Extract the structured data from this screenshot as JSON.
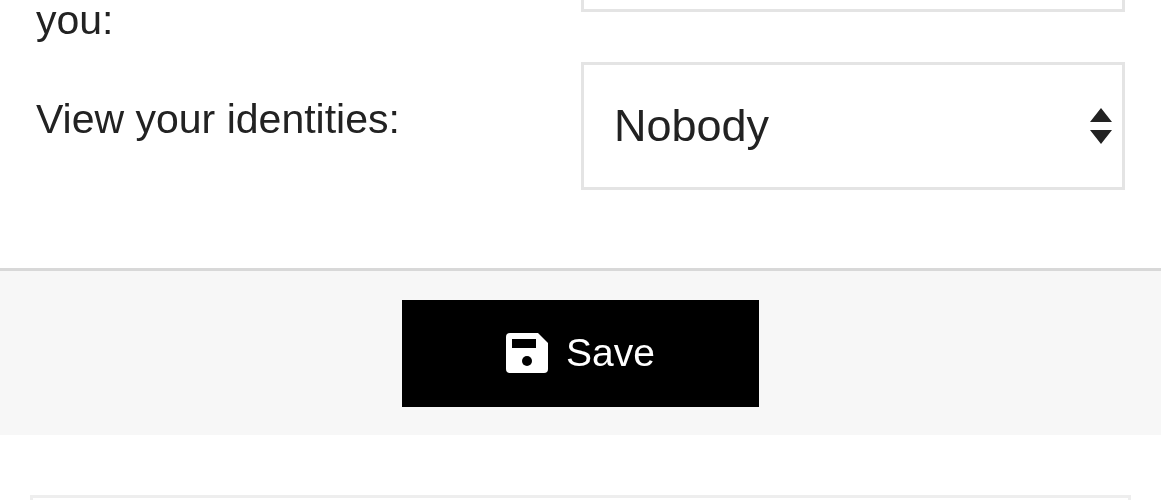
{
  "rows": [
    {
      "label": "you:",
      "value": ""
    },
    {
      "label": "View your identities:",
      "value": "Nobody"
    }
  ],
  "save_button": {
    "label": "Save"
  }
}
